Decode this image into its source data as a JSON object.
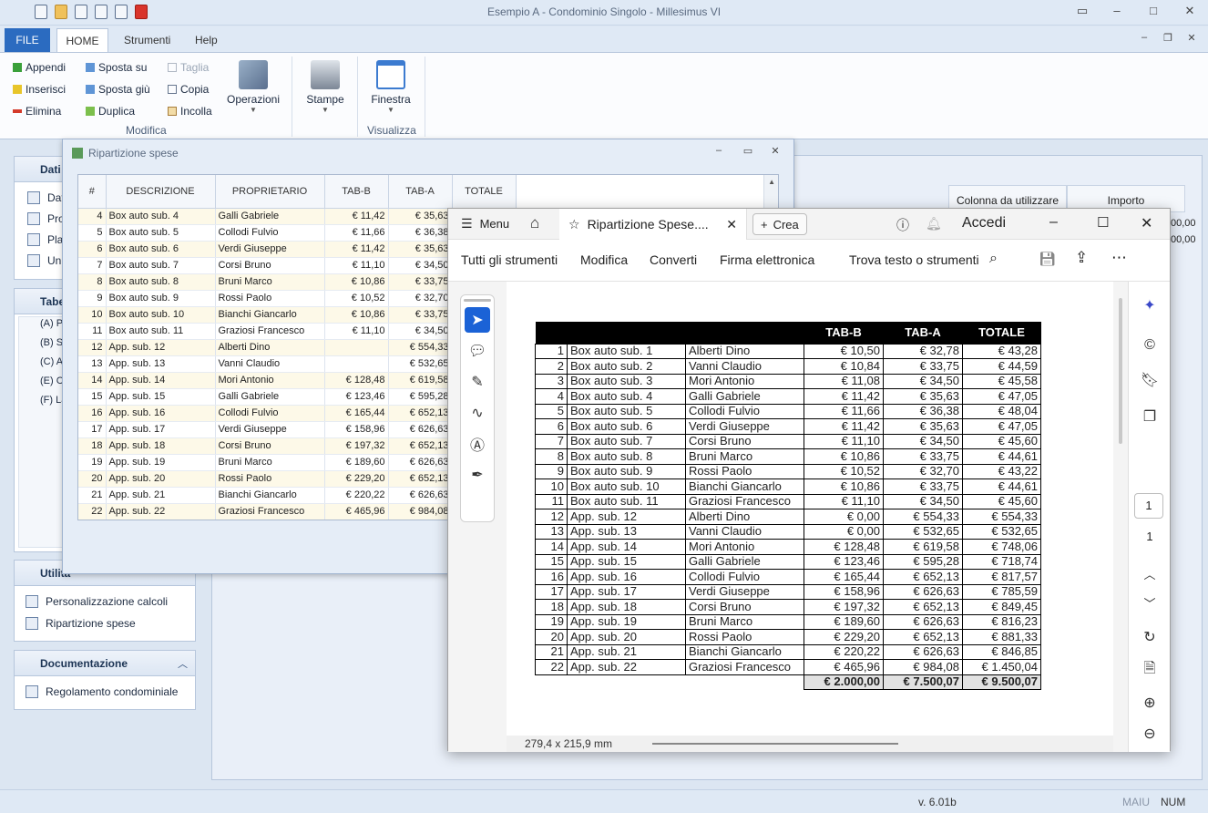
{
  "window": {
    "title": "Esempio A - Condominio Singolo - Millesimus VI"
  },
  "menu_tabs": [
    "FILE",
    "HOME",
    "Strumenti",
    "Help"
  ],
  "ribbon": {
    "modifica": {
      "append": "Appendi",
      "insert": "Inserisci",
      "delete": "Elimina",
      "move_up": "Sposta su",
      "move_down": "Sposta giù",
      "duplicate": "Duplica",
      "cut": "Taglia",
      "copy": "Copia",
      "paste": "Incolla",
      "operations": "Operazioni",
      "group_label": "Modifica"
    },
    "stampe": "Stampe",
    "finestra": "Finestra",
    "visualizza_label": "Visualizza"
  },
  "nav": {
    "dati_head": "Dati",
    "dati_items": [
      "Dat",
      "Pro",
      "Pla",
      "Uni"
    ],
    "tabelle_head": "Tabe",
    "tabelle_items": [
      "(A) Pr",
      "(B) Sc",
      "(C) As",
      "(E) Co",
      "(F) La"
    ],
    "utility_head": "Utilità",
    "utility_items": [
      "Personalizzazione calcoli",
      "Ripartizione spese"
    ],
    "doc_head": "Documentazione",
    "doc_items": [
      "Regolamento condominiale"
    ]
  },
  "bg_table": {
    "col1": "Colonna da utilizzare",
    "col2": "Importo",
    "v1": "00,00",
    "v2": "00,00"
  },
  "rip_window": {
    "title": "Ripartizione spese",
    "headers": [
      "#",
      "DESCRIZIONE",
      "PROPRIETARIO",
      "TAB-B",
      "TAB-A",
      "TOTALE"
    ],
    "rows": [
      [
        "4",
        "Box auto sub. 4",
        "Galli Gabriele",
        "€ 11,42",
        "€ 35,63"
      ],
      [
        "5",
        "Box auto sub. 5",
        "Collodi Fulvio",
        "€ 11,66",
        "€ 36,38"
      ],
      [
        "6",
        "Box auto sub. 6",
        "Verdi Giuseppe",
        "€ 11,42",
        "€ 35,63"
      ],
      [
        "7",
        "Box auto sub. 7",
        "Corsi Bruno",
        "€ 11,10",
        "€ 34,50"
      ],
      [
        "8",
        "Box auto sub. 8",
        "Bruni Marco",
        "€ 10,86",
        "€ 33,75"
      ],
      [
        "9",
        "Box auto sub. 9",
        "Rossi Paolo",
        "€ 10,52",
        "€ 32,70"
      ],
      [
        "10",
        "Box auto sub. 10",
        "Bianchi Giancarlo",
        "€ 10,86",
        "€ 33,75"
      ],
      [
        "11",
        "Box auto sub. 11",
        "Graziosi Francesco",
        "€ 11,10",
        "€ 34,50"
      ],
      [
        "12",
        "App. sub. 12",
        "Alberti Dino",
        "",
        "€ 554,33"
      ],
      [
        "13",
        "App. sub. 13",
        "Vanni Claudio",
        "",
        "€ 532,65"
      ],
      [
        "14",
        "App. sub. 14",
        "Mori Antonio",
        "€ 128,48",
        "€ 619,58"
      ],
      [
        "15",
        "App. sub. 15",
        "Galli Gabriele",
        "€ 123,46",
        "€ 595,28"
      ],
      [
        "16",
        "App. sub. 16",
        "Collodi Fulvio",
        "€ 165,44",
        "€ 652,13"
      ],
      [
        "17",
        "App. sub. 17",
        "Verdi Giuseppe",
        "€ 158,96",
        "€ 626,63"
      ],
      [
        "18",
        "App. sub. 18",
        "Corsi Bruno",
        "€ 197,32",
        "€ 652,13"
      ],
      [
        "19",
        "App. sub. 19",
        "Bruni Marco",
        "€ 189,60",
        "€ 626,63"
      ],
      [
        "20",
        "App. sub. 20",
        "Rossi Paolo",
        "€ 229,20",
        "€ 652,13"
      ],
      [
        "21",
        "App. sub. 21",
        "Bianchi Giancarlo",
        "€ 220,22",
        "€ 626,63"
      ],
      [
        "22",
        "App. sub. 22",
        "Graziosi Francesco",
        "€ 465,96",
        "€ 984,08"
      ]
    ]
  },
  "pdf": {
    "menu": "Menu",
    "tab_title": "Ripartizione Spese....",
    "create": "Crea",
    "signin": "Accedi",
    "toolbar": [
      "Tutti gli strumenti",
      "Modifica",
      "Converti",
      "Firma elettronica"
    ],
    "search": "Trova testo o strumenti",
    "page_current": "1",
    "page_total": "1",
    "dimensions": "279,4 x 215,9 mm",
    "headers": [
      "TAB-B",
      "TAB-A",
      "TOTALE"
    ],
    "rows": [
      [
        "1",
        "Box auto sub. 1",
        "Alberti Dino",
        "€ 10,50",
        "€ 32,78",
        "€ 43,28"
      ],
      [
        "2",
        "Box auto sub. 2",
        "Vanni Claudio",
        "€ 10,84",
        "€ 33,75",
        "€ 44,59"
      ],
      [
        "3",
        "Box auto sub. 3",
        "Mori Antonio",
        "€ 11,08",
        "€ 34,50",
        "€ 45,58"
      ],
      [
        "4",
        "Box auto sub. 4",
        "Galli Gabriele",
        "€ 11,42",
        "€ 35,63",
        "€ 47,05"
      ],
      [
        "5",
        "Box auto sub. 5",
        "Collodi Fulvio",
        "€ 11,66",
        "€ 36,38",
        "€ 48,04"
      ],
      [
        "6",
        "Box auto sub. 6",
        "Verdi Giuseppe",
        "€ 11,42",
        "€ 35,63",
        "€ 47,05"
      ],
      [
        "7",
        "Box auto sub. 7",
        "Corsi Bruno",
        "€ 11,10",
        "€ 34,50",
        "€ 45,60"
      ],
      [
        "8",
        "Box auto sub. 8",
        "Bruni Marco",
        "€ 10,86",
        "€ 33,75",
        "€ 44,61"
      ],
      [
        "9",
        "Box auto sub. 9",
        "Rossi Paolo",
        "€ 10,52",
        "€ 32,70",
        "€ 43,22"
      ],
      [
        "10",
        "Box auto sub. 10",
        "Bianchi Giancarlo",
        "€ 10,86",
        "€ 33,75",
        "€ 44,61"
      ],
      [
        "11",
        "Box auto sub. 11",
        "Graziosi Francesco",
        "€ 11,10",
        "€ 34,50",
        "€ 45,60"
      ],
      [
        "12",
        "App. sub. 12",
        "Alberti Dino",
        "€ 0,00",
        "€ 554,33",
        "€ 554,33"
      ],
      [
        "13",
        "App. sub. 13",
        "Vanni Claudio",
        "€ 0,00",
        "€ 532,65",
        "€ 532,65"
      ],
      [
        "14",
        "App. sub. 14",
        "Mori Antonio",
        "€ 128,48",
        "€ 619,58",
        "€ 748,06"
      ],
      [
        "15",
        "App. sub. 15",
        "Galli Gabriele",
        "€ 123,46",
        "€ 595,28",
        "€ 718,74"
      ],
      [
        "16",
        "App. sub. 16",
        "Collodi Fulvio",
        "€ 165,44",
        "€ 652,13",
        "€ 817,57"
      ],
      [
        "17",
        "App. sub. 17",
        "Verdi Giuseppe",
        "€ 158,96",
        "€ 626,63",
        "€ 785,59"
      ],
      [
        "18",
        "App. sub. 18",
        "Corsi Bruno",
        "€ 197,32",
        "€ 652,13",
        "€ 849,45"
      ],
      [
        "19",
        "App. sub. 19",
        "Bruni Marco",
        "€ 189,60",
        "€ 626,63",
        "€ 816,23"
      ],
      [
        "20",
        "App. sub. 20",
        "Rossi Paolo",
        "€ 229,20",
        "€ 652,13",
        "€ 881,33"
      ],
      [
        "21",
        "App. sub. 21",
        "Bianchi Giancarlo",
        "€ 220,22",
        "€ 626,63",
        "€ 846,85"
      ],
      [
        "22",
        "App. sub. 22",
        "Graziosi Francesco",
        "€ 465,96",
        "€ 984,08",
        "€ 1.450,04"
      ]
    ],
    "totals": [
      "€ 2.000,00",
      "€ 7.500,07",
      "€ 9.500,07"
    ]
  },
  "status": {
    "version": "v. 6.01b",
    "caps": "MAIU",
    "num": "NUM"
  },
  "colors": {
    "file_tab": "#2b6bc0",
    "pdf_select": "#1b62d6"
  }
}
